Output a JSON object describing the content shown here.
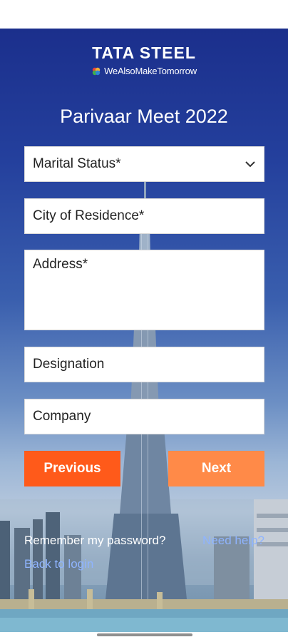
{
  "brand": {
    "name": "TATA STEEL",
    "tagline": "WeAlsoMakeTomorrow"
  },
  "event_title": "Parivaar Meet 2022",
  "form": {
    "marital_status": {
      "placeholder": "Marital Status*",
      "icon": "chevron-down-icon"
    },
    "city": {
      "placeholder": "City of Residence*"
    },
    "address": {
      "placeholder": "Address*"
    },
    "designation": {
      "placeholder": "Designation"
    },
    "company": {
      "placeholder": "Company"
    }
  },
  "buttons": {
    "previous": "Previous",
    "next": "Next"
  },
  "links": {
    "remember": "Remember my password?",
    "help": "Need help?",
    "back": "Back to login"
  },
  "colors": {
    "previous_button": "#ff5a1a",
    "next_button": "#ff8a48",
    "link": "#8fb4ff",
    "sky_top": "#1b2f8c"
  }
}
